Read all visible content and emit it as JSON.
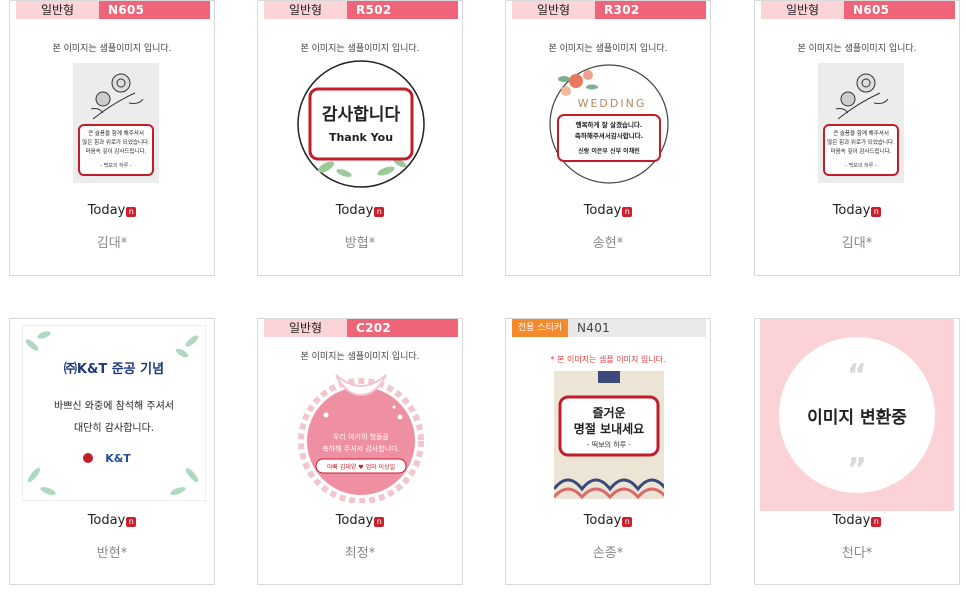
{
  "items": [
    {
      "type": "일반형",
      "code": "N605",
      "note": "본 이미지는 샘플이미지 입니다.",
      "today": "Today",
      "badge": "n",
      "name": "김대*",
      "art": {
        "lines": [
          "큰 슬픔을 함께 해주셔서",
          "많은 힘과 위로가 되었습니다.",
          "마음속 깊이 감사드립니다."
        ],
        "sign": "- 백보의 하루 -"
      }
    },
    {
      "type": "일반형",
      "code": "R502",
      "note": "본 이미지는 샘플이미지 입니다.",
      "today": "Today",
      "badge": "n",
      "name": "방협*",
      "art": {
        "title": "감사합니다",
        "sub": "Thank You"
      }
    },
    {
      "type": "일반형",
      "code": "R302",
      "note": "본 이미지는 샘플이미지 입니다.",
      "today": "Today",
      "badge": "n",
      "name": "송현*",
      "art": {
        "title": "WEDDING",
        "lines": [
          "행복하게 잘 살겠습니다.",
          "축하해주셔서감사합니다."
        ],
        "sign": "신랑 이은우 신부 이채린"
      }
    },
    {
      "type": "일반형",
      "code": "N605",
      "note": "본 이미지는 샘플이미지 입니다.",
      "today": "Today",
      "badge": "n",
      "name": "김대*",
      "art": {
        "lines": [
          "큰 슬픔을 함께 해주셔서",
          "많은 힘과 위로가 되었습니다.",
          "마음속 깊이 감사드립니다."
        ],
        "sign": "- 백보의 하루 -"
      }
    },
    {
      "today": "Today",
      "badge": "n",
      "name": "반현*",
      "art": {
        "title": "㈜K&T 준공 기념",
        "lines": [
          "바쁘신 와중에 참석해 주셔서",
          "대단히 감사합니다."
        ],
        "logo": "K&T"
      }
    },
    {
      "type": "일반형",
      "code": "C202",
      "note": "본 이미지는 샘플이미지 입니다.",
      "today": "Today",
      "badge": "n",
      "name": "최정*",
      "art": {
        "lines": [
          "우리 아기의 첫돌을",
          "축하해 주셔서 감사합니다."
        ],
        "sign": "아빠 김태양 ♥ 엄마 이상일"
      }
    },
    {
      "type": "전용 스티커",
      "code": "N401",
      "note": "* 본 이미지는 샘플 이미지 입니다.",
      "today": "Today",
      "badge": "n",
      "name": "손종*",
      "art": {
        "lines": [
          "즐거운",
          "명절 보내세요"
        ],
        "sign": "- 떡보의 하루 -"
      }
    },
    {
      "today": "Today",
      "badge": "n",
      "name": "천다*",
      "art": {
        "title": "이미지 변환중",
        "quote_open": "“",
        "quote_close": "”"
      }
    }
  ]
}
